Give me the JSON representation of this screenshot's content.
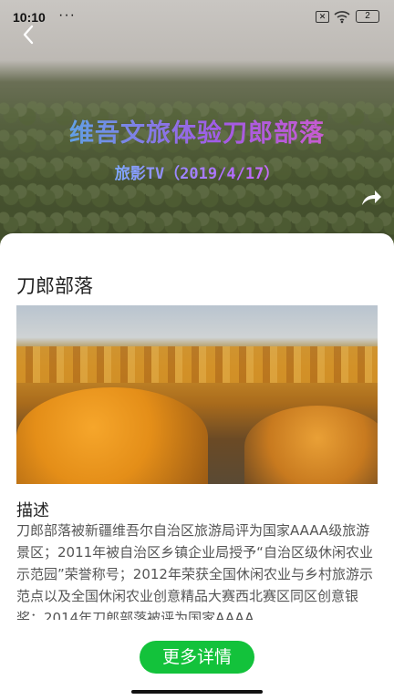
{
  "status_bar": {
    "time": "10:10",
    "dots": "···",
    "sim_symbol": "✕",
    "battery": "2"
  },
  "video": {
    "overlay_title": "维吾文旅体验刀郎部落",
    "overlay_subtitle": "旅影TV（2019/4/17）"
  },
  "detail": {
    "title": "刀郎部落",
    "description_heading": "描述",
    "description": "刀郎部落被新疆维吾尔自治区旅游局评为国家AAAA级旅游景区；2011年被自治区乡镇企业局授予“自治区级休闲农业示范园”荣誉称号；2012年荣获全国休闲农业与乡村旅游示范点以及全国休闲农业创意精品大赛西北赛区同区创意银奖；2014年刀郎部落被评为国家AAAA",
    "more_button": "更多详情"
  },
  "colors": {
    "accent": "#13c23b"
  },
  "icons": [
    "back-arrow-icon",
    "share-icon",
    "wifi-icon",
    "battery-icon",
    "sim-icon"
  ]
}
